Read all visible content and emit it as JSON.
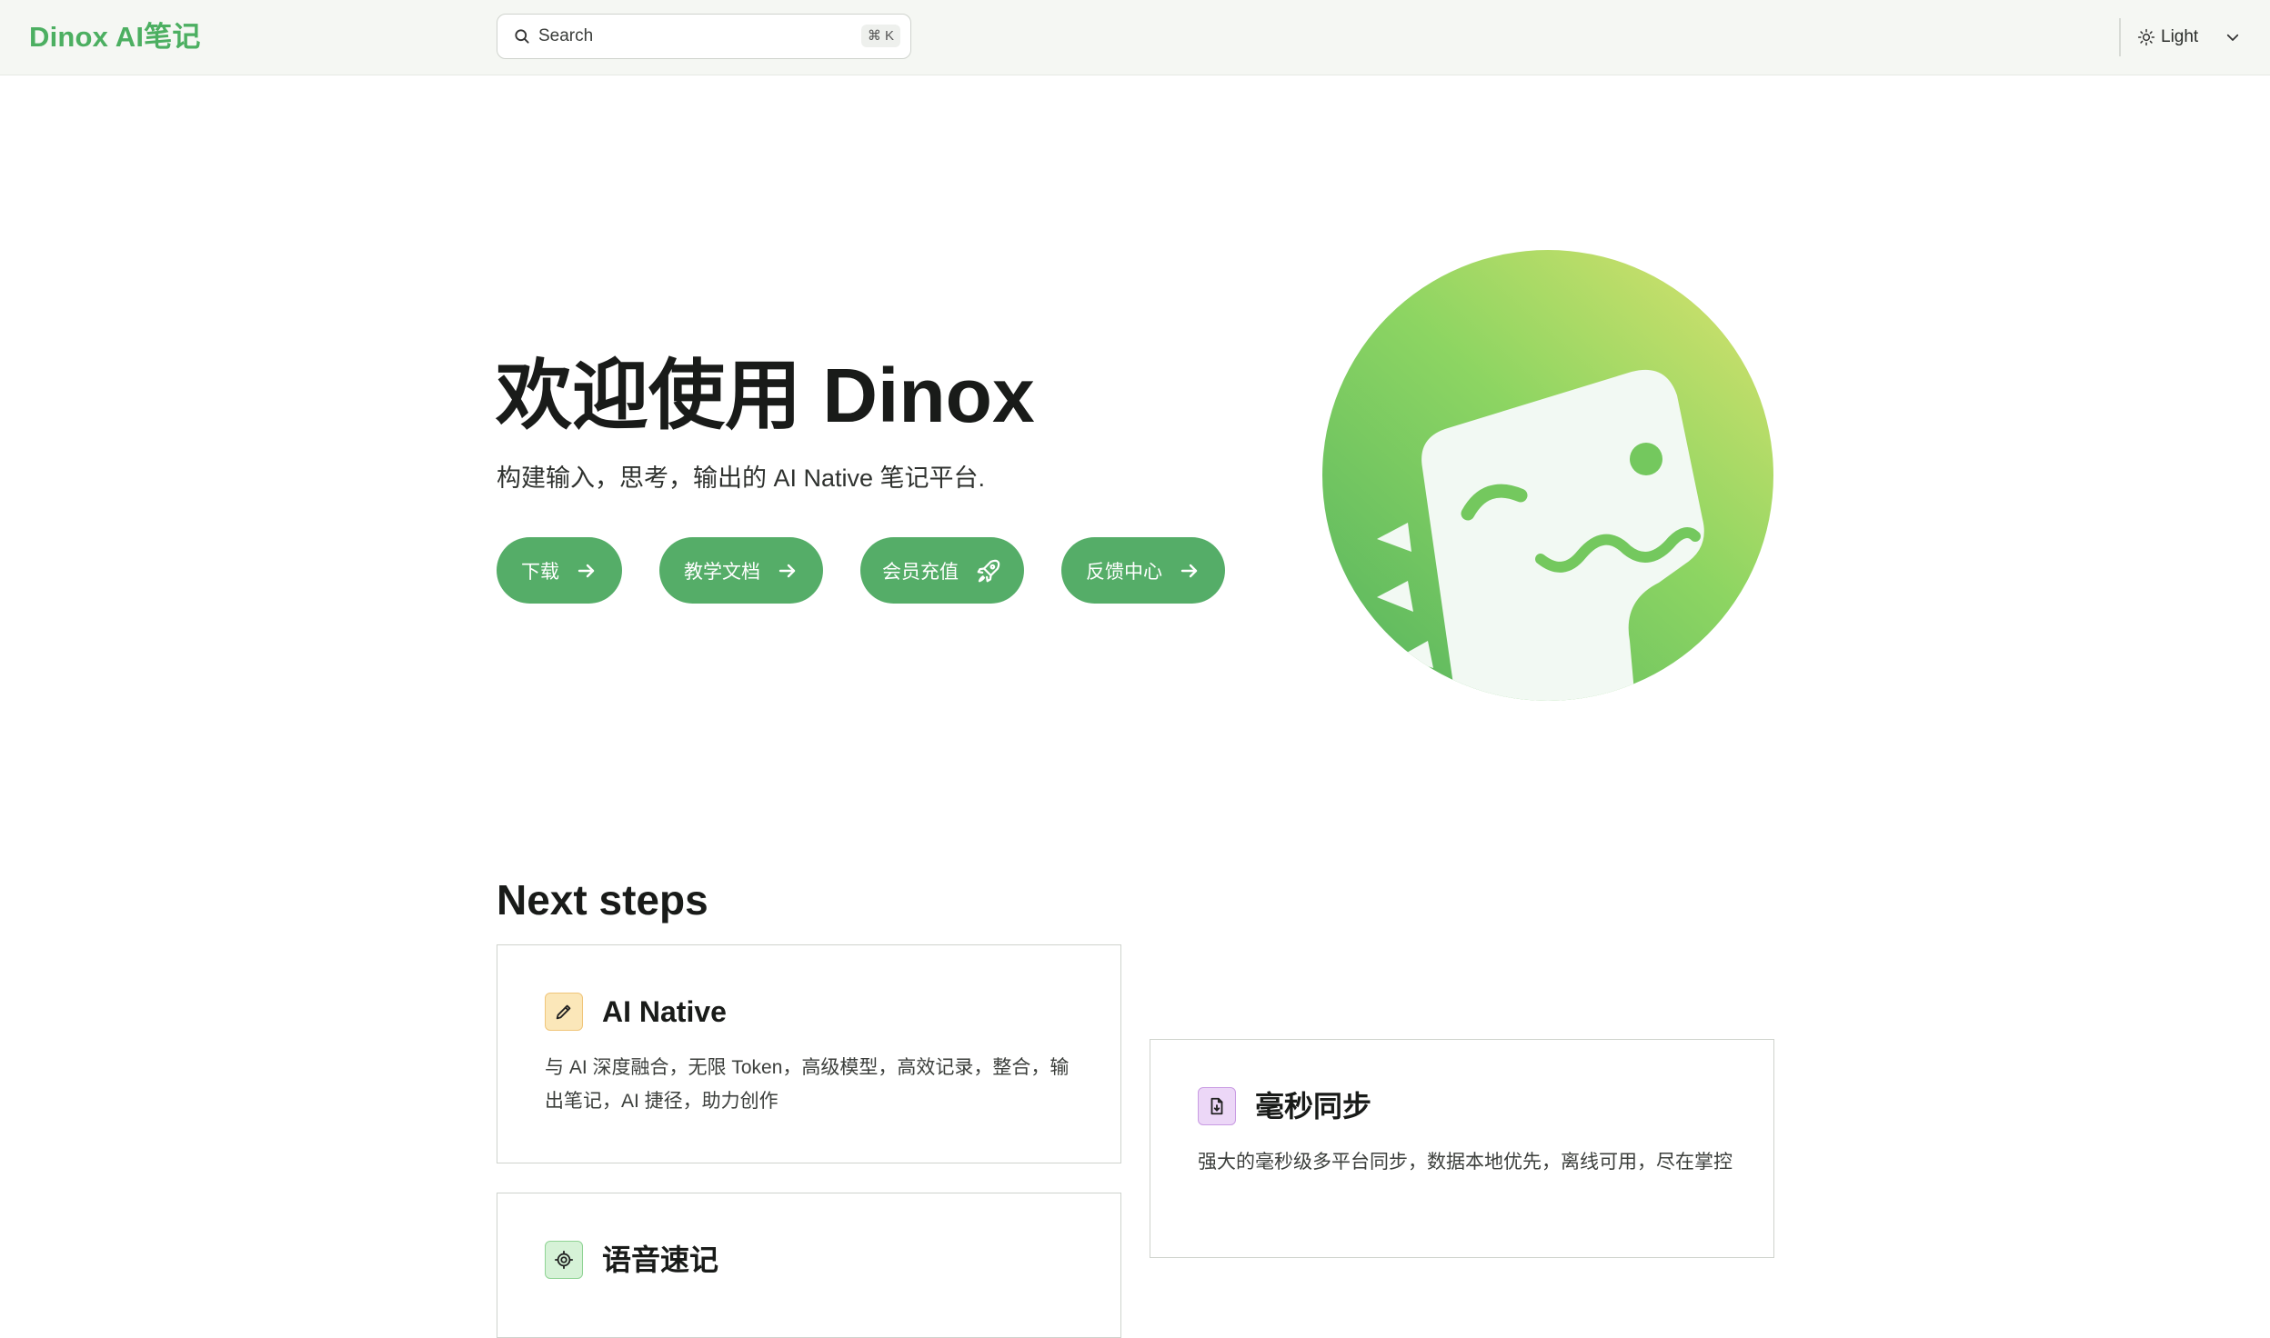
{
  "header": {
    "logo": "Dinox AI笔记",
    "search": {
      "placeholder": "Search",
      "shortcut": "⌘ K"
    },
    "theme": {
      "label": "Light"
    }
  },
  "hero": {
    "title": "欢迎使用 Dinox",
    "subtitle": "构建输入，思考，输出的 AI Native 笔记平台.",
    "buttons": [
      {
        "label": "下载",
        "icon": "arrow-right-icon"
      },
      {
        "label": "教学文档",
        "icon": "arrow-right-icon"
      },
      {
        "label": "会员充值",
        "icon": "rocket-icon"
      },
      {
        "label": "反馈中心",
        "icon": "arrow-right-icon"
      }
    ]
  },
  "next_steps": {
    "title": "Next steps",
    "cards": [
      {
        "title": "AI Native",
        "description": "与 AI 深度融合，无限 Token，高级模型，高效记录，整合，输出笔记，AI 捷径，助力创作",
        "icon": "pencil-icon"
      },
      {
        "title": "毫秒同步",
        "description": "强大的毫秒级多平台同步，数据本地优先，离线可用，尽在掌控",
        "icon": "document-icon"
      },
      {
        "title": "语音速记",
        "description": "",
        "icon": "gear-icon"
      }
    ]
  },
  "colors": {
    "brand": "#4caf61",
    "button": "#55ad68",
    "header_bg": "#f5f7f3"
  }
}
